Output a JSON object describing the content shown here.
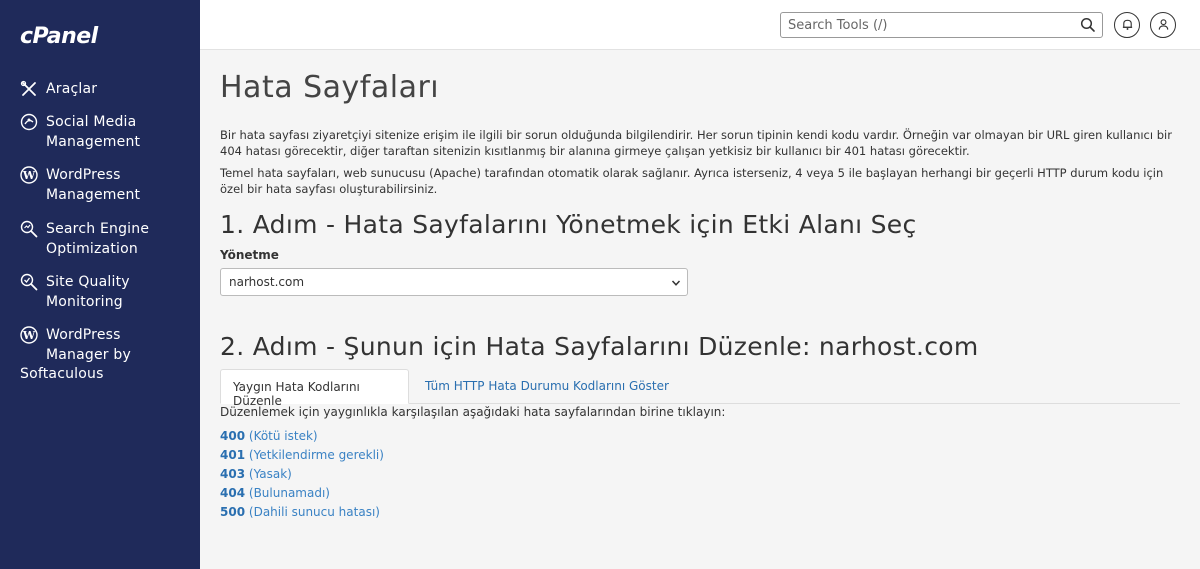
{
  "app": {
    "logo": "cPanel"
  },
  "sidebar": {
    "items": [
      {
        "label": "Araçlar"
      },
      {
        "label": "Social Media\nManagement"
      },
      {
        "label": "WordPress\nManagement"
      },
      {
        "label": "Search Engine\nOptimization"
      },
      {
        "label": "Site Quality\nMonitoring"
      },
      {
        "label": "WordPress\n Manager by"
      }
    ],
    "last_line": "Softaculous"
  },
  "header": {
    "search_placeholder": "Search Tools (/)"
  },
  "main": {
    "title": "Hata Sayfaları",
    "desc1": "Bir hata sayfası ziyaretçiyi sitenize erişim ile ilgili bir sorun olduğunda bilgilendirir. Her sorun tipinin kendi kodu vardır. Örneğin var olmayan bir URL giren kullanıcı bir 404 hatası görecektir, diğer taraftan sitenizin kısıtlanmış bir alanına girmeye çalışan yetkisiz bir kullanıcı bir 401 hatası görecektir.",
    "desc2": "Temel hata sayfaları, web sunucusu (Apache) tarafından otomatik olarak sağlanır. Ayrıca isterseniz, 4 veya 5 ile başlayan herhangi bir geçerli HTTP durum kodu için özel bir hata sayfası oluşturabilirsiniz.",
    "step1": "1. Adım - Hata Sayfalarını Yönetmek için Etki Alanı Seç",
    "manage_label": "Yönetme",
    "domain_selected": "narhost.com",
    "step2": "2. Adım - Şunun için Hata Sayfalarını Düzenle: narhost.com",
    "tabs": [
      {
        "label": "Yaygın Hata Kodlarını Düzenle"
      },
      {
        "label": "Tüm HTTP Hata Durumu Kodlarını Göster"
      }
    ],
    "hint": "Düzenlemek için yaygınlıkla karşılaşılan aşağıdaki hata sayfalarından birine tıklayın:",
    "codes": [
      {
        "code": "400",
        "text": "(Kötü istek)"
      },
      {
        "code": "401",
        "text": "(Yetkilendirme gerekli)"
      },
      {
        "code": "403",
        "text": "(Yasak)"
      },
      {
        "code": "404",
        "text": "(Bulunamadı)"
      },
      {
        "code": "500",
        "text": "(Dahili sunucu hatası)"
      }
    ]
  },
  "colors": {
    "sidebar_bg": "#1f2a5a",
    "link": "#3a82c4",
    "link_bold": "#2a6fb0"
  }
}
